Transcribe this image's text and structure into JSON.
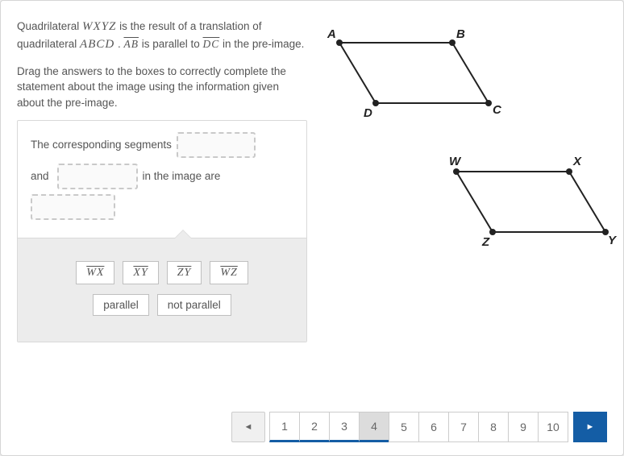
{
  "prompt": {
    "line1_pre": "Quadrilateral ",
    "wxyz": "WXYZ",
    "line1_mid": " is the result of a translation of quadrilateral ",
    "abcd": "ABCD",
    "line1_post": " . ",
    "ab": "AB",
    "parallel_to": " is parallel to ",
    "dc": "DC",
    "line1_end": " in the pre-image.",
    "line2": "Drag the answers to the boxes to correctly complete the statement about the image using the information given about the pre-image."
  },
  "sentence": {
    "s1": "The corresponding segments",
    "s2": "and",
    "s3": "in the image are"
  },
  "tiles_row1": [
    {
      "label": "WX"
    },
    {
      "label": "XY"
    },
    {
      "label": "ZY"
    },
    {
      "label": "WZ"
    }
  ],
  "tiles_row2": [
    {
      "label": "parallel"
    },
    {
      "label": "not parallel"
    }
  ],
  "diagram": {
    "abcd": {
      "A": "A",
      "B": "B",
      "C": "C",
      "D": "D"
    },
    "wxyz": {
      "W": "W",
      "X": "X",
      "Y": "Y",
      "Z": "Z"
    }
  },
  "pagination": {
    "pages": [
      "1",
      "2",
      "3",
      "4",
      "5",
      "6",
      "7",
      "8",
      "9",
      "10"
    ],
    "active": "4",
    "prev_icon": "◄",
    "next_icon": "►"
  }
}
